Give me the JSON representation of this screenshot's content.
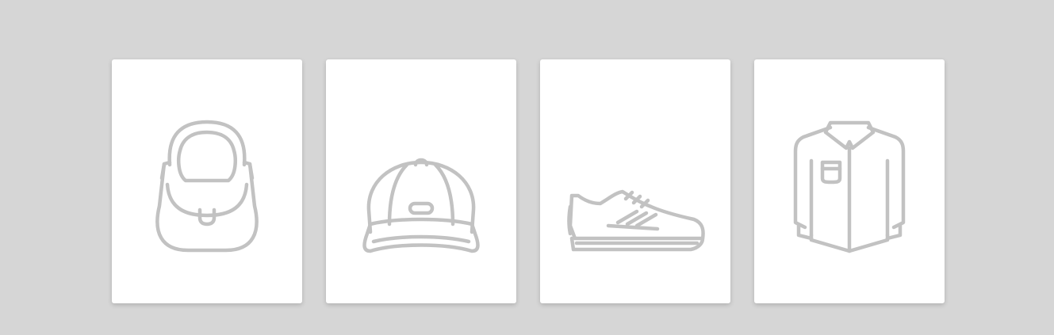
{
  "colors": {
    "background": "#d6d6d6",
    "card": "#ffffff",
    "icon_stroke": "#c2c2c2"
  },
  "cards": [
    {
      "icon": "handbag-icon"
    },
    {
      "icon": "baseball-cap-icon"
    },
    {
      "icon": "sneaker-icon"
    },
    {
      "icon": "shirt-icon"
    }
  ]
}
